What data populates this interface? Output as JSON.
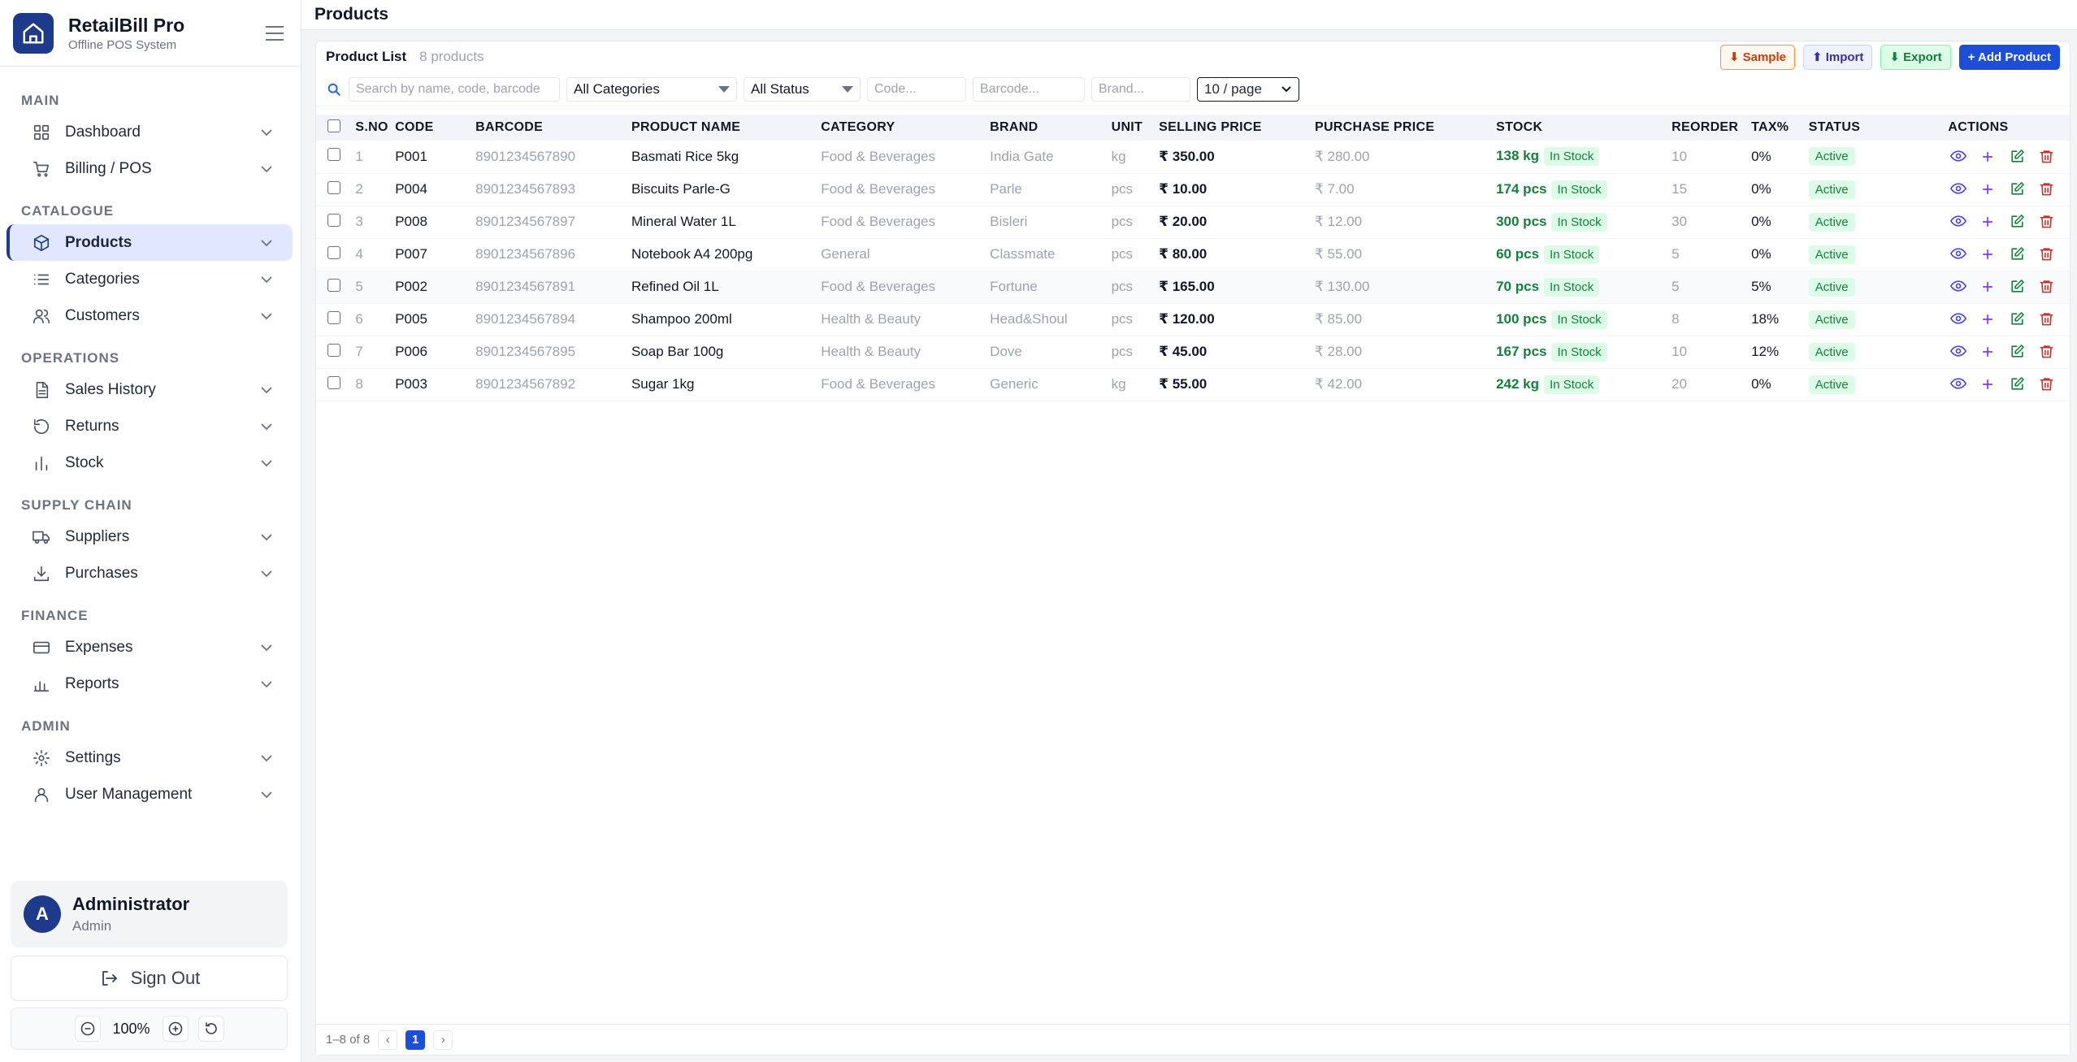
{
  "brand": {
    "name": "RetailBill Pro",
    "subtitle": "Offline POS System"
  },
  "page": {
    "title": "Products"
  },
  "sidebar": {
    "sections": [
      {
        "label": "MAIN",
        "items": [
          {
            "label": "Dashboard",
            "icon": "grid-icon"
          },
          {
            "label": "Billing / POS",
            "icon": "cart-icon"
          }
        ]
      },
      {
        "label": "CATALOGUE",
        "items": [
          {
            "label": "Products",
            "icon": "box-icon",
            "active": true
          },
          {
            "label": "Categories",
            "icon": "list-icon"
          },
          {
            "label": "Customers",
            "icon": "users-icon"
          }
        ]
      },
      {
        "label": "OPERATIONS",
        "items": [
          {
            "label": "Sales History",
            "icon": "document-icon"
          },
          {
            "label": "Returns",
            "icon": "undo-icon"
          },
          {
            "label": "Stock",
            "icon": "bar-chart-icon"
          }
        ]
      },
      {
        "label": "SUPPLY CHAIN",
        "items": [
          {
            "label": "Suppliers",
            "icon": "truck-icon"
          },
          {
            "label": "Purchases",
            "icon": "download-icon"
          }
        ]
      },
      {
        "label": "FINANCE",
        "items": [
          {
            "label": "Expenses",
            "icon": "credit-card-icon"
          },
          {
            "label": "Reports",
            "icon": "reports-icon"
          }
        ]
      },
      {
        "label": "ADMIN",
        "items": [
          {
            "label": "Settings",
            "icon": "gear-icon"
          },
          {
            "label": "User Management",
            "icon": "user-icon"
          }
        ]
      }
    ]
  },
  "user": {
    "initial": "A",
    "name": "Administrator",
    "role": "Admin"
  },
  "signout_label": "Sign Out",
  "zoom": {
    "value": "100%"
  },
  "card": {
    "title": "Product List",
    "count": "8 products",
    "buttons": {
      "sample": "⬇ Sample",
      "import": "⬆ Import",
      "export": "⬇ Export",
      "add": "+ Add Product"
    }
  },
  "filters": {
    "search_placeholder": "Search by name, code, barcode",
    "category": "All Categories",
    "status": "All Status",
    "code_placeholder": "Code...",
    "barcode_placeholder": "Barcode...",
    "brand_placeholder": "Brand...",
    "per_page": "10 / page"
  },
  "table": {
    "headers": [
      "S.NO",
      "CODE",
      "BARCODE",
      "PRODUCT NAME",
      "CATEGORY",
      "BRAND",
      "UNIT",
      "SELLING PRICE",
      "PURCHASE PRICE",
      "STOCK",
      "REORDER",
      "TAX%",
      "STATUS",
      "ACTIONS"
    ],
    "rows": [
      {
        "sno": "1",
        "code": "P001",
        "barcode": "8901234567890",
        "name": "Basmati Rice 5kg",
        "category": "Food & Beverages",
        "brand": "India Gate",
        "unit": "kg",
        "selling": "₹ 350.00",
        "purchase": "₹ 280.00",
        "stock": "138 kg",
        "stock_badge": "In Stock",
        "reorder": "10",
        "tax": "0%",
        "status": "Active"
      },
      {
        "sno": "2",
        "code": "P004",
        "barcode": "8901234567893",
        "name": "Biscuits Parle-G",
        "category": "Food & Beverages",
        "brand": "Parle",
        "unit": "pcs",
        "selling": "₹ 10.00",
        "purchase": "₹ 7.00",
        "stock": "174 pcs",
        "stock_badge": "In Stock",
        "reorder": "15",
        "tax": "0%",
        "status": "Active"
      },
      {
        "sno": "3",
        "code": "P008",
        "barcode": "8901234567897",
        "name": "Mineral Water 1L",
        "category": "Food & Beverages",
        "brand": "Bisleri",
        "unit": "pcs",
        "selling": "₹ 20.00",
        "purchase": "₹ 12.00",
        "stock": "300 pcs",
        "stock_badge": "In Stock",
        "reorder": "30",
        "tax": "0%",
        "status": "Active"
      },
      {
        "sno": "4",
        "code": "P007",
        "barcode": "8901234567896",
        "name": "Notebook A4 200pg",
        "category": "General",
        "brand": "Classmate",
        "unit": "pcs",
        "selling": "₹ 80.00",
        "purchase": "₹ 55.00",
        "stock": "60 pcs",
        "stock_badge": "In Stock",
        "reorder": "5",
        "tax": "0%",
        "status": "Active"
      },
      {
        "sno": "5",
        "code": "P002",
        "barcode": "8901234567891",
        "name": "Refined Oil 1L",
        "category": "Food & Beverages",
        "brand": "Fortune",
        "unit": "pcs",
        "selling": "₹ 165.00",
        "purchase": "₹ 130.00",
        "stock": "70 pcs",
        "stock_badge": "In Stock",
        "reorder": "5",
        "tax": "5%",
        "status": "Active"
      },
      {
        "sno": "6",
        "code": "P005",
        "barcode": "8901234567894",
        "name": "Shampoo 200ml",
        "category": "Health & Beauty",
        "brand": "Head&Shoul",
        "unit": "pcs",
        "selling": "₹ 120.00",
        "purchase": "₹ 85.00",
        "stock": "100 pcs",
        "stock_badge": "In Stock",
        "reorder": "8",
        "tax": "18%",
        "status": "Active"
      },
      {
        "sno": "7",
        "code": "P006",
        "barcode": "8901234567895",
        "name": "Soap Bar 100g",
        "category": "Health & Beauty",
        "brand": "Dove",
        "unit": "pcs",
        "selling": "₹ 45.00",
        "purchase": "₹ 28.00",
        "stock": "167 pcs",
        "stock_badge": "In Stock",
        "reorder": "10",
        "tax": "12%",
        "status": "Active"
      },
      {
        "sno": "8",
        "code": "P003",
        "barcode": "8901234567892",
        "name": "Sugar 1kg",
        "category": "Food & Beverages",
        "brand": "Generic",
        "unit": "kg",
        "selling": "₹ 55.00",
        "purchase": "₹ 42.00",
        "stock": "242 kg",
        "stock_badge": "In Stock",
        "reorder": "20",
        "tax": "0%",
        "status": "Active"
      }
    ]
  },
  "pagination": {
    "range": "1–8 of 8",
    "prev": "‹",
    "current": "1",
    "next": "›"
  },
  "colors": {
    "brand": "#1e3a8a",
    "accent": "#1d4ed8",
    "success": "#15803d",
    "danger": "#dc2626",
    "view": "#4f46e5",
    "add": "#7c3aed"
  }
}
